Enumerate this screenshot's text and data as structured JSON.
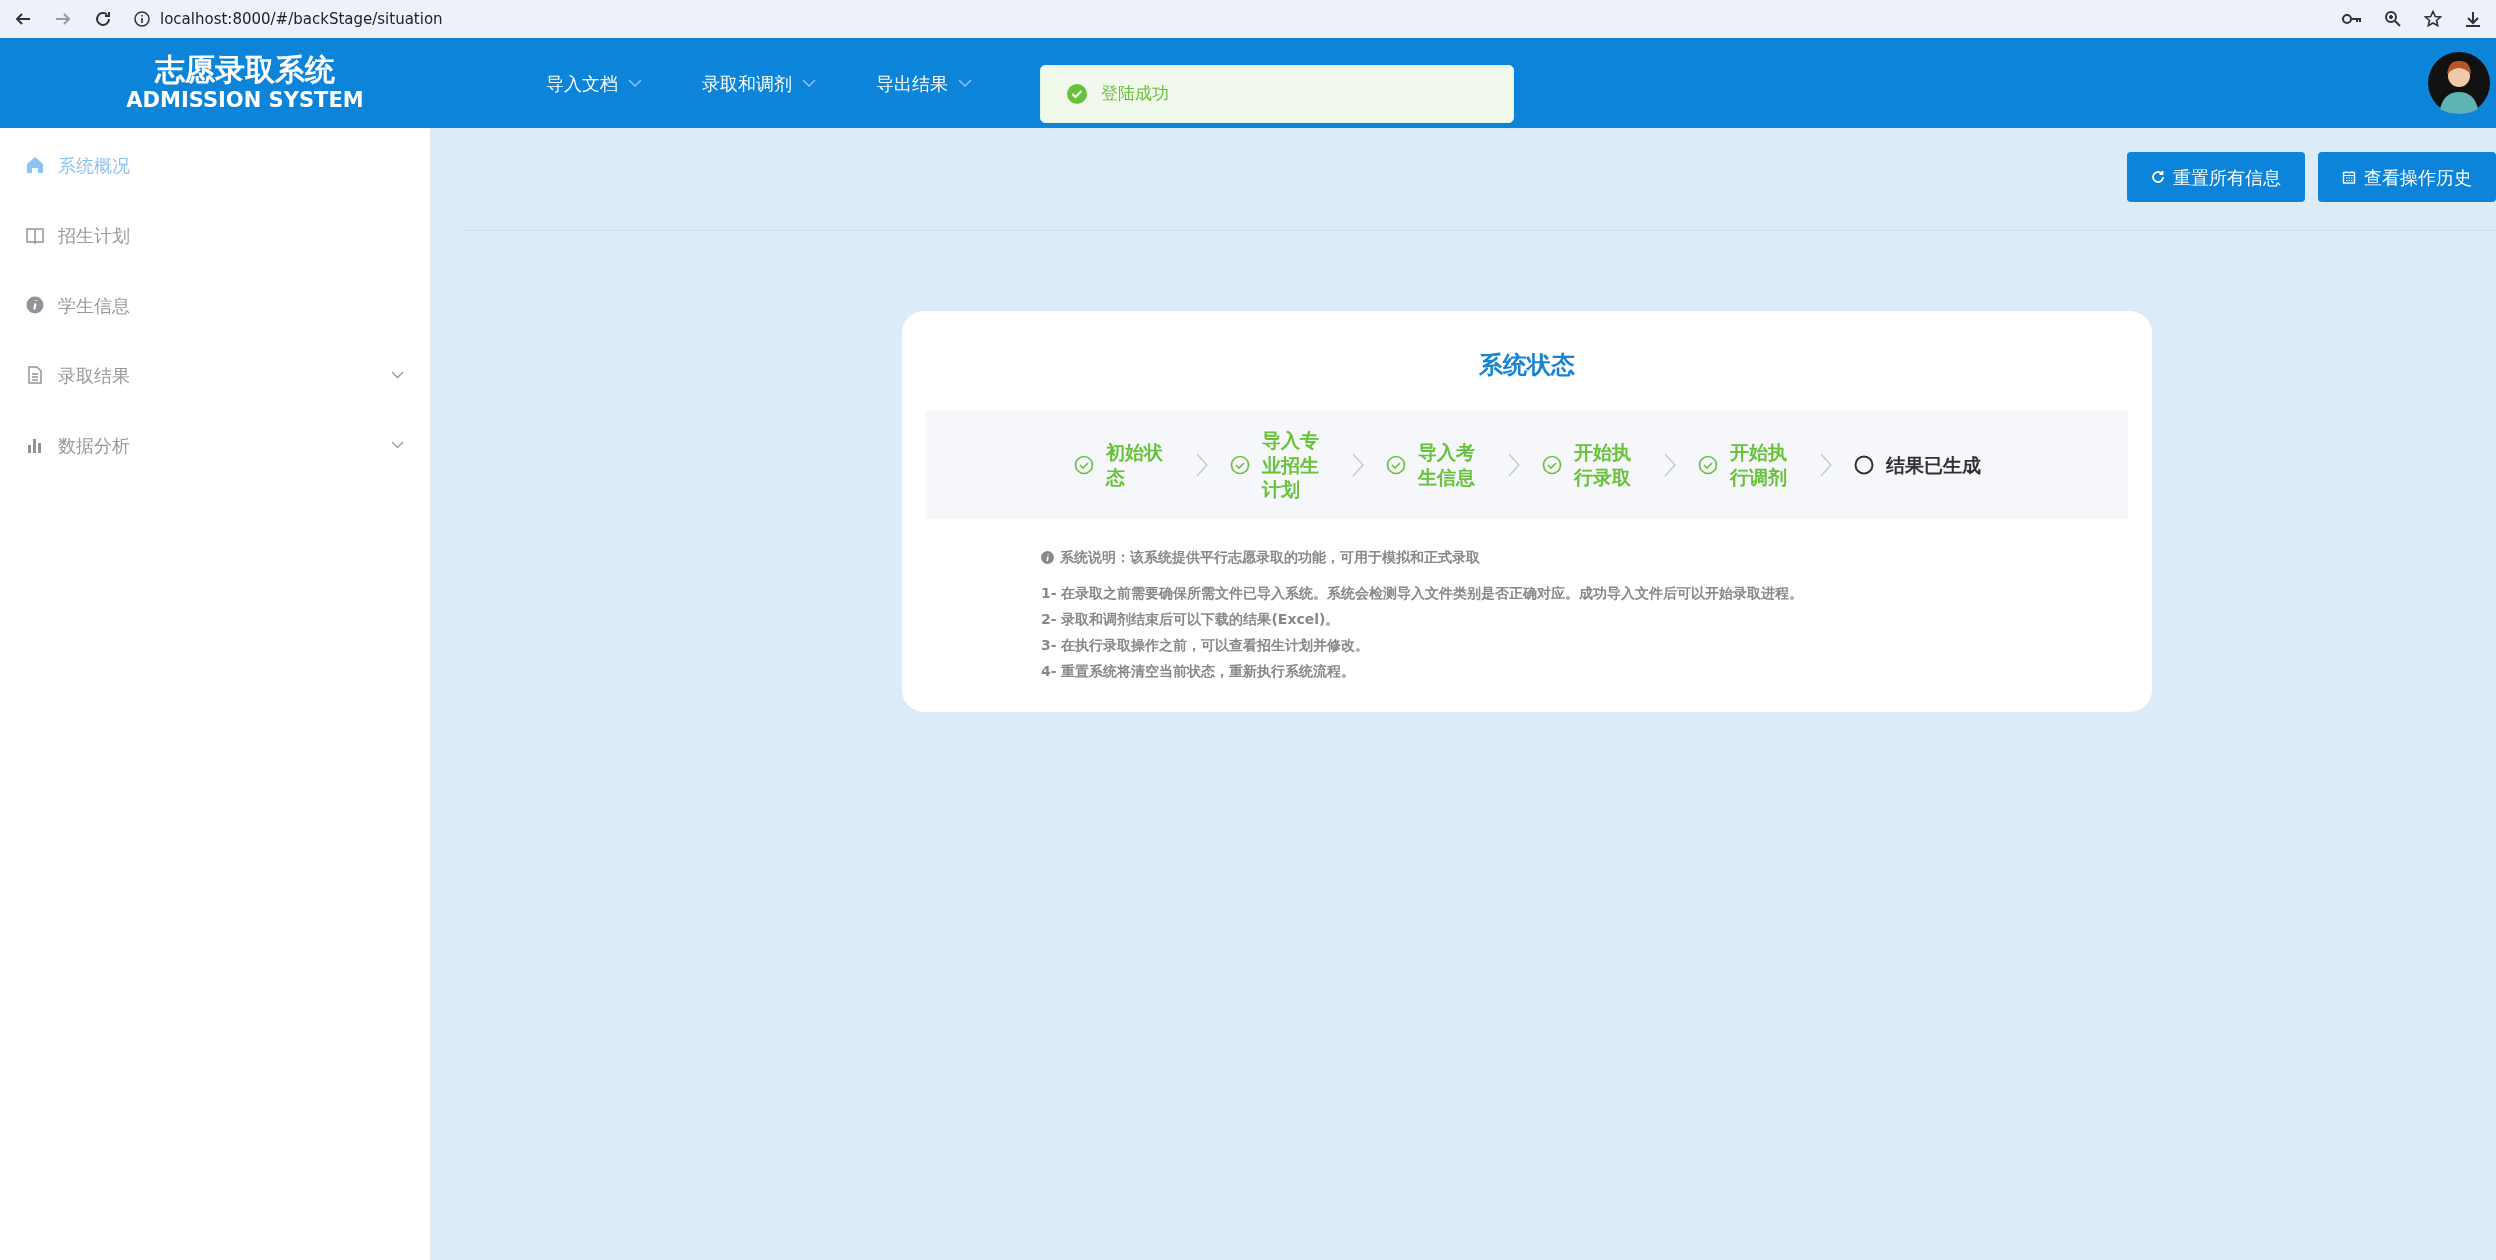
{
  "browser": {
    "url": "localhost:8000/#/backStage/situation"
  },
  "header": {
    "title": "志愿录取系统",
    "subtitle": "ADMISSION SYSTEM",
    "menu": [
      {
        "label": "导入文档"
      },
      {
        "label": "录取和调剂"
      },
      {
        "label": "导出结果"
      }
    ]
  },
  "toast": {
    "message": "登陆成功"
  },
  "sidebar": {
    "items": [
      {
        "label": "系统概况",
        "selected": true,
        "expandable": false
      },
      {
        "label": "招生计划",
        "selected": false,
        "expandable": false
      },
      {
        "label": "学生信息",
        "selected": false,
        "expandable": false
      },
      {
        "label": "录取结果",
        "selected": false,
        "expandable": true
      },
      {
        "label": "数据分析",
        "selected": false,
        "expandable": true
      }
    ]
  },
  "actions": [
    {
      "label": "重置所有信息"
    },
    {
      "label": "查看操作历史"
    }
  ],
  "status_card": {
    "title": "系统状态",
    "steps": [
      {
        "label": "初始状态",
        "done": true
      },
      {
        "label": "导入专业招生计划",
        "done": true
      },
      {
        "label": "导入考生信息",
        "done": true
      },
      {
        "label": "开始执行录取",
        "done": true
      },
      {
        "label": "开始执行调剂",
        "done": true
      },
      {
        "label": "结果已生成",
        "done": false
      }
    ],
    "note": "系统说明：该系统提供平行志愿录取的功能，可用于模拟和正式录取",
    "lines": [
      "1- 在录取之前需要确保所需文件已导入系统。系统会检测导入文件类别是否正确对应。成功导入文件后可以开始录取进程。",
      "2- 录取和调剂结束后可以下载的结果(Excel)。",
      "3- 在执行录取操作之前，可以查看招生计划并修改。",
      "4- 重置系统将清空当前状态，重新执行系统流程。"
    ]
  }
}
